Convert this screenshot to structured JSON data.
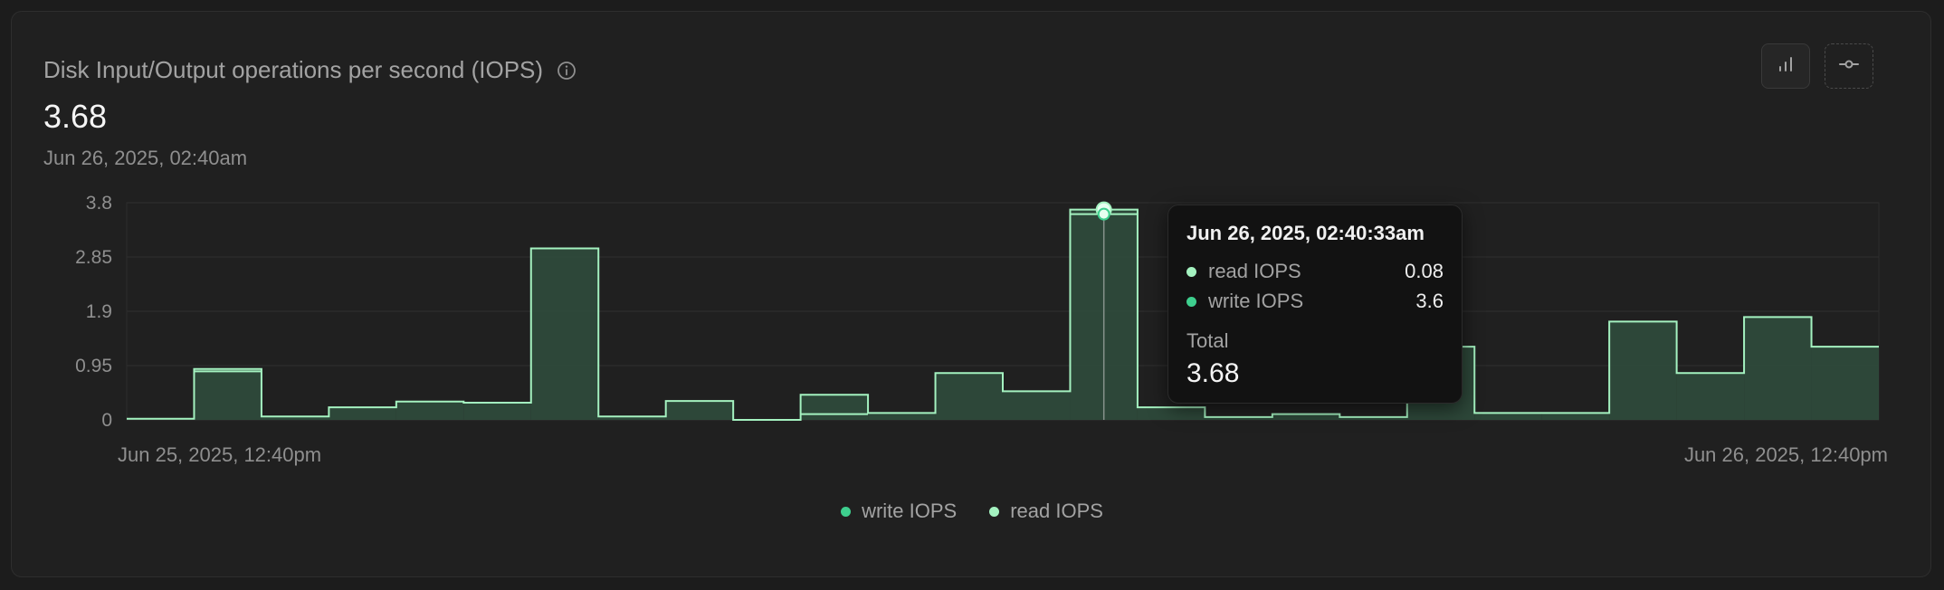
{
  "header": {
    "title": "Disk Input/Output operations per second (IOPS)",
    "value": "3.68",
    "date": "Jun 26, 2025, 02:40am"
  },
  "toolbar": {
    "bar_view_icon": "bar-chart-icon",
    "line_view_icon": "line-chart-icon"
  },
  "colors": {
    "write": "#3ecf8e",
    "read": "#a4f2c0",
    "fill": "#2f4b3c"
  },
  "chart_data": {
    "type": "area",
    "stacked": true,
    "step": true,
    "y_ticks": [
      "3.8",
      "2.85",
      "1.9",
      "0.95",
      "0"
    ],
    "ylim": [
      0,
      3.8
    ],
    "x_start_label": "Jun 25, 2025, 12:40pm",
    "x_end_label": "Jun 26, 2025, 12:40pm",
    "series": [
      {
        "name": "write IOPS",
        "values": [
          0.02,
          0.85,
          0.06,
          0.22,
          0.32,
          0.3,
          3.0,
          0.06,
          0.33,
          0.0,
          0.1,
          0.12,
          0.82,
          0.5,
          3.6,
          0.22,
          0.05,
          0.1,
          0.05,
          1.28,
          0.12,
          0.12,
          1.72,
          0.82,
          1.8,
          1.28
        ]
      },
      {
        "name": "read IOPS",
        "values": [
          0.0,
          0.04,
          0.0,
          0.0,
          0.0,
          0.0,
          0.0,
          0.0,
          0.0,
          0.0,
          0.34,
          0.0,
          0.0,
          0.0,
          0.08,
          0.0,
          0.0,
          0.0,
          0.0,
          0.0,
          0.0,
          0.0,
          0.0,
          0.0,
          0.0,
          0.0
        ]
      }
    ],
    "highlight_index": 14
  },
  "tooltip": {
    "date": "Jun 26, 2025, 02:40:33am",
    "rows": [
      {
        "label": "read IOPS",
        "value": "0.08"
      },
      {
        "label": "write IOPS",
        "value": "3.6"
      }
    ],
    "total_label": "Total",
    "total_value": "3.68"
  },
  "legend": [
    {
      "label": "write IOPS"
    },
    {
      "label": "read IOPS"
    }
  ]
}
